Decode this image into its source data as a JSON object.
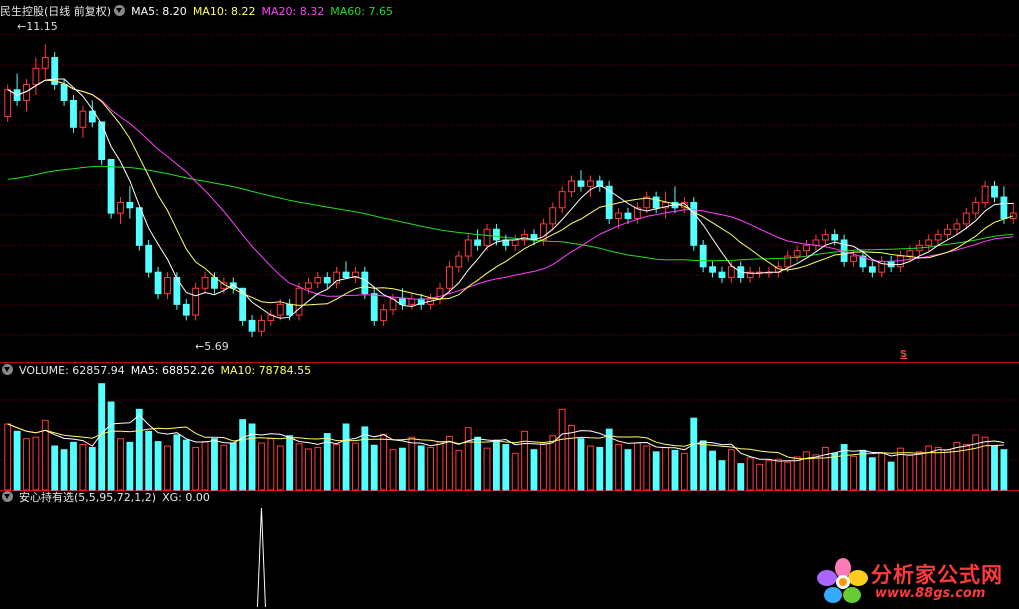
{
  "header_main": {
    "name": "民生控股(日线 前复权)",
    "ma5": "MA5: 8.20",
    "ma10": "MA10: 8.22",
    "ma20": "MA20: 8.32",
    "ma60": "MA60: 7.65"
  },
  "header_volume": {
    "label": "VOLUME: 62857.94",
    "ma5": "MA5: 68852.26",
    "ma10": "MA10: 78784.55"
  },
  "header_indicator": {
    "label": "安心持有选(5,5,95,72,1,2)",
    "xg": "XG: 0.00"
  },
  "annotations": {
    "high": "11.15",
    "low": "5.69",
    "signal": "S"
  },
  "logo": {
    "title": "分析家公式网",
    "url": "www.88gs.com"
  },
  "colors": {
    "up": "#ff3a3a",
    "down": "#54ffff",
    "ma5": "#ffffff",
    "ma10": "#ffff66",
    "ma20": "#ff40ff",
    "ma60": "#22dd22",
    "grid": "#7a0000",
    "separator": "#cc0000"
  },
  "chart_data": {
    "type": "candlestick",
    "price_axis": [
      5.3,
      11.6
    ],
    "ohlc": [
      [
        9.8,
        10.4,
        9.7,
        10.3
      ],
      [
        10.3,
        10.6,
        10.0,
        10.1
      ],
      [
        10.1,
        10.5,
        9.9,
        10.4
      ],
      [
        10.4,
        10.9,
        10.2,
        10.7
      ],
      [
        10.7,
        11.15,
        10.5,
        10.9
      ],
      [
        10.9,
        11.0,
        10.3,
        10.4
      ],
      [
        10.4,
        10.5,
        10.0,
        10.1
      ],
      [
        10.1,
        10.2,
        9.5,
        9.6
      ],
      [
        9.6,
        10.0,
        9.4,
        9.9
      ],
      [
        9.9,
        10.1,
        9.6,
        9.7
      ],
      [
        9.7,
        9.7,
        8.9,
        9.0
      ],
      [
        9.0,
        9.0,
        7.9,
        8.0
      ],
      [
        8.0,
        8.3,
        7.8,
        8.2
      ],
      [
        8.2,
        8.5,
        7.9,
        8.1
      ],
      [
        8.1,
        8.1,
        7.3,
        7.4
      ],
      [
        7.4,
        7.5,
        6.8,
        6.9
      ],
      [
        6.9,
        7.0,
        6.4,
        6.5
      ],
      [
        6.5,
        6.9,
        6.4,
        6.8
      ],
      [
        6.8,
        6.9,
        6.2,
        6.3
      ],
      [
        6.3,
        6.4,
        6.0,
        6.1
      ],
      [
        6.1,
        6.7,
        6.0,
        6.6
      ],
      [
        6.6,
        6.9,
        6.5,
        6.8
      ],
      [
        6.8,
        6.9,
        6.5,
        6.6
      ],
      [
        6.6,
        6.8,
        6.5,
        6.7
      ],
      [
        6.7,
        6.8,
        6.5,
        6.6
      ],
      [
        6.6,
        6.6,
        5.9,
        6.0
      ],
      [
        6.0,
        6.1,
        5.69,
        5.8
      ],
      [
        5.8,
        6.1,
        5.7,
        6.0
      ],
      [
        6.0,
        6.2,
        5.9,
        6.1
      ],
      [
        6.1,
        6.4,
        6.0,
        6.3
      ],
      [
        6.3,
        6.4,
        6.0,
        6.1
      ],
      [
        6.1,
        6.7,
        6.0,
        6.6
      ],
      [
        6.6,
        6.8,
        6.5,
        6.7
      ],
      [
        6.7,
        6.9,
        6.6,
        6.8
      ],
      [
        6.8,
        6.9,
        6.6,
        6.7
      ],
      [
        6.7,
        7.0,
        6.6,
        6.9
      ],
      [
        6.9,
        7.1,
        6.8,
        6.8
      ],
      [
        6.8,
        7.0,
        6.7,
        6.9
      ],
      [
        6.9,
        7.0,
        6.4,
        6.5
      ],
      [
        6.5,
        6.6,
        5.9,
        6.0
      ],
      [
        6.0,
        6.3,
        5.9,
        6.2
      ],
      [
        6.2,
        6.5,
        6.1,
        6.4
      ],
      [
        6.4,
        6.6,
        6.2,
        6.3
      ],
      [
        6.3,
        6.5,
        6.2,
        6.4
      ],
      [
        6.4,
        6.5,
        6.2,
        6.3
      ],
      [
        6.3,
        6.5,
        6.2,
        6.4
      ],
      [
        6.4,
        6.7,
        6.3,
        6.6
      ],
      [
        6.6,
        7.1,
        6.5,
        7.0
      ],
      [
        7.0,
        7.3,
        6.9,
        7.2
      ],
      [
        7.2,
        7.6,
        7.1,
        7.5
      ],
      [
        7.5,
        7.7,
        7.3,
        7.4
      ],
      [
        7.4,
        7.8,
        7.3,
        7.7
      ],
      [
        7.7,
        7.8,
        7.4,
        7.5
      ],
      [
        7.5,
        7.6,
        7.3,
        7.4
      ],
      [
        7.4,
        7.6,
        7.3,
        7.5
      ],
      [
        7.5,
        7.7,
        7.4,
        7.6
      ],
      [
        7.6,
        7.7,
        7.4,
        7.5
      ],
      [
        7.5,
        7.9,
        7.4,
        7.8
      ],
      [
        7.8,
        8.2,
        7.7,
        8.1
      ],
      [
        8.1,
        8.5,
        8.0,
        8.4
      ],
      [
        8.4,
        8.7,
        8.3,
        8.6
      ],
      [
        8.6,
        8.8,
        8.4,
        8.5
      ],
      [
        8.5,
        8.7,
        8.3,
        8.6
      ],
      [
        8.6,
        8.7,
        8.4,
        8.5
      ],
      [
        8.5,
        8.6,
        7.8,
        7.9
      ],
      [
        7.9,
        8.1,
        7.7,
        8.0
      ],
      [
        8.0,
        8.1,
        7.8,
        7.9
      ],
      [
        7.9,
        8.2,
        7.8,
        8.1
      ],
      [
        8.1,
        8.4,
        8.0,
        8.3
      ],
      [
        8.3,
        8.4,
        8.0,
        8.1
      ],
      [
        8.1,
        8.4,
        7.9,
        8.2
      ],
      [
        8.2,
        8.5,
        8.0,
        8.1
      ],
      [
        8.1,
        8.3,
        8.0,
        8.2
      ],
      [
        8.2,
        8.3,
        7.3,
        7.4
      ],
      [
        7.4,
        7.5,
        6.9,
        7.0
      ],
      [
        7.0,
        7.1,
        6.8,
        6.9
      ],
      [
        6.9,
        7.0,
        6.7,
        6.8
      ],
      [
        6.8,
        7.1,
        6.7,
        7.0
      ],
      [
        7.0,
        7.1,
        6.7,
        6.8
      ],
      [
        6.8,
        7.0,
        6.7,
        6.9
      ],
      [
        6.9,
        7.0,
        6.8,
        6.9
      ],
      [
        6.9,
        7.0,
        6.8,
        6.9
      ],
      [
        6.9,
        7.1,
        6.8,
        7.0
      ],
      [
        7.0,
        7.3,
        6.9,
        7.2
      ],
      [
        7.2,
        7.4,
        7.1,
        7.3
      ],
      [
        7.3,
        7.5,
        7.2,
        7.4
      ],
      [
        7.4,
        7.6,
        7.3,
        7.5
      ],
      [
        7.5,
        7.7,
        7.4,
        7.6
      ],
      [
        7.6,
        7.7,
        7.4,
        7.5
      ],
      [
        7.5,
        7.6,
        7.0,
        7.1
      ],
      [
        7.1,
        7.3,
        7.0,
        7.2
      ],
      [
        7.2,
        7.3,
        6.9,
        7.0
      ],
      [
        7.0,
        7.1,
        6.8,
        6.9
      ],
      [
        6.9,
        7.2,
        6.8,
        7.1
      ],
      [
        7.1,
        7.2,
        6.9,
        7.0
      ],
      [
        7.0,
        7.3,
        6.9,
        7.2
      ],
      [
        7.2,
        7.4,
        7.1,
        7.3
      ],
      [
        7.3,
        7.5,
        7.2,
        7.4
      ],
      [
        7.4,
        7.6,
        7.3,
        7.5
      ],
      [
        7.5,
        7.7,
        7.4,
        7.6
      ],
      [
        7.6,
        7.8,
        7.5,
        7.7
      ],
      [
        7.7,
        7.9,
        7.6,
        7.8
      ],
      [
        7.8,
        8.1,
        7.7,
        8.0
      ],
      [
        8.0,
        8.3,
        7.9,
        8.2
      ],
      [
        8.2,
        8.6,
        8.1,
        8.5
      ],
      [
        8.5,
        8.6,
        8.2,
        8.3
      ],
      [
        8.3,
        8.5,
        7.8,
        7.9
      ],
      [
        7.9,
        8.2,
        7.8,
        8.0
      ]
    ],
    "volume_axis": [
      0,
      150000
    ],
    "volumes": [
      90000,
      80000,
      70000,
      72000,
      95000,
      60000,
      55000,
      65000,
      62000,
      58000,
      145000,
      120000,
      70000,
      65000,
      110000,
      80000,
      66000,
      60000,
      75000,
      68000,
      58000,
      66000,
      70000,
      61000,
      64000,
      96000,
      90000,
      64000,
      70000,
      60000,
      74000,
      63000,
      56000,
      58000,
      77000,
      62000,
      90000,
      64000,
      86000,
      61000,
      76000,
      55000,
      57000,
      72000,
      60000,
      58000,
      66000,
      73000,
      54000,
      85000,
      72000,
      57000,
      68000,
      62000,
      50000,
      80000,
      55000,
      63000,
      74000,
      110000,
      88000,
      70000,
      60000,
      58000,
      83000,
      62000,
      55000,
      64000,
      60000,
      52000,
      58000,
      54000,
      50000,
      98000,
      67000,
      53000,
      40000,
      55000,
      36000,
      44000,
      35000,
      40000,
      42000,
      38000,
      45000,
      52000,
      48000,
      58000,
      50000,
      62000,
      46000,
      54000,
      44000,
      50000,
      38000,
      57000,
      48000,
      52000,
      60000,
      58000,
      55000,
      65000,
      62000,
      75000,
      72000,
      60000,
      55000
    ],
    "indicator_axis": [
      0,
      1
    ],
    "xg_signal_index": 27,
    "xg_value": 0.0,
    "moving_averages": [
      "MA5",
      "MA10",
      "MA20",
      "MA60"
    ]
  }
}
